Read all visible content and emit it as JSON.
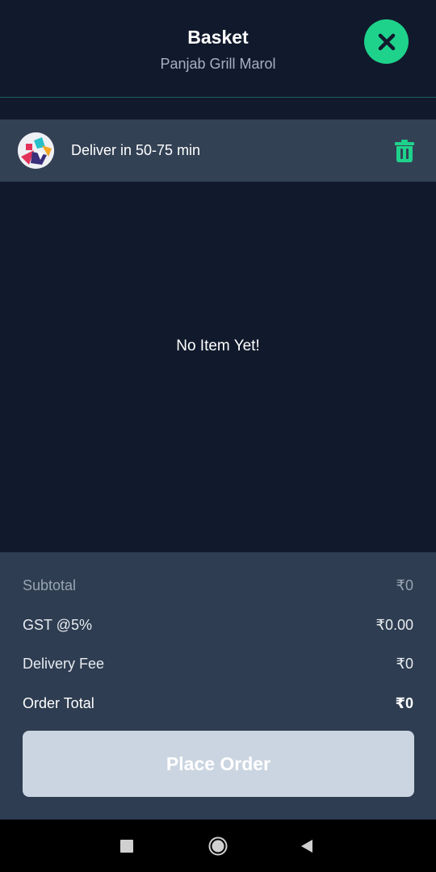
{
  "header": {
    "title": "Basket",
    "subtitle": "Panjab Grill Marol",
    "close_icon": "close-x-icon"
  },
  "delivery": {
    "text": "Deliver in 50-75 min",
    "avatar_icon": "restaurant-logo",
    "trash_icon": "trash-icon"
  },
  "basket": {
    "empty_message": "No Item Yet!"
  },
  "summary": {
    "rows": [
      {
        "label": "Subtotal",
        "value": "₹0"
      },
      {
        "label": "GST @5%",
        "value": "₹0.00"
      },
      {
        "label": "Delivery Fee",
        "value": "₹0"
      },
      {
        "label": "Order Total",
        "value": "₹0"
      }
    ],
    "place_order_label": "Place Order"
  },
  "colors": {
    "background": "#111a2c",
    "accent": "#1ed28c",
    "panel": "#2e3d51",
    "button_disabled": "#cbd5e1"
  },
  "nav": {
    "recent_icon": "square-icon",
    "home_icon": "circle-home-icon",
    "back_icon": "triangle-back-icon"
  }
}
